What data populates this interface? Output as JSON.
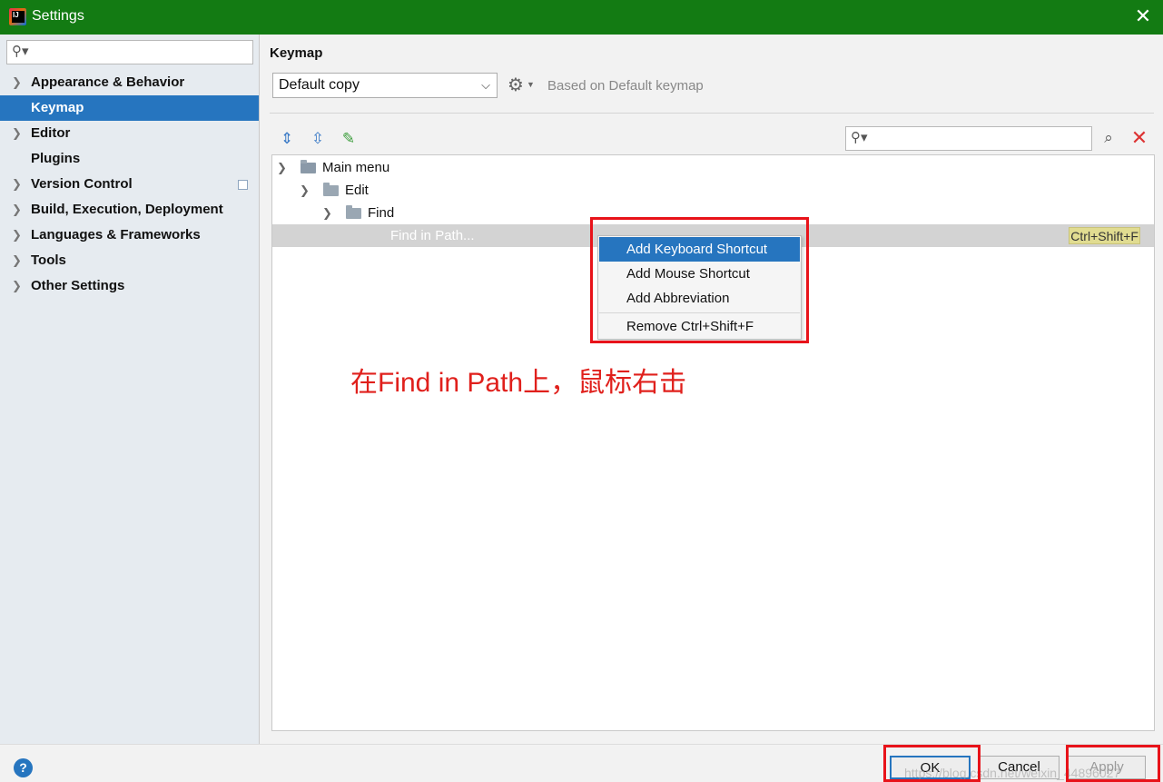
{
  "window": {
    "title": "Settings",
    "close_glyph": "✕",
    "icon": "intellij-idea-icon"
  },
  "sidebar": {
    "search_placeholder": "",
    "items": [
      {
        "label": "Appearance & Behavior",
        "expandable": true,
        "selected": false
      },
      {
        "label": "Keymap",
        "expandable": false,
        "selected": true
      },
      {
        "label": "Editor",
        "expandable": true,
        "selected": false
      },
      {
        "label": "Plugins",
        "expandable": false,
        "selected": false
      },
      {
        "label": "Version Control",
        "expandable": true,
        "selected": false
      },
      {
        "label": "Build, Execution, Deployment",
        "expandable": true,
        "selected": false
      },
      {
        "label": "Languages & Frameworks",
        "expandable": true,
        "selected": false
      },
      {
        "label": "Tools",
        "expandable": true,
        "selected": false
      },
      {
        "label": "Other Settings",
        "expandable": true,
        "selected": false
      }
    ]
  },
  "main": {
    "title": "Keymap",
    "keymap_select_value": "Default copy",
    "based_on": "Based on Default keymap",
    "tree": [
      {
        "label": "Main menu"
      },
      {
        "label": "Edit"
      },
      {
        "label": "Find"
      },
      {
        "label": "Find in Path...",
        "shortcut": "Ctrl+Shift+F"
      }
    ]
  },
  "context_menu": {
    "items": [
      {
        "label": "Add Keyboard Shortcut",
        "active": true
      },
      {
        "label": "Add Mouse Shortcut",
        "active": false
      },
      {
        "label": "Add Abbreviation",
        "active": false
      },
      {
        "label": "Remove Ctrl+Shift+F",
        "active": false
      }
    ]
  },
  "annotation": "在Find in Path上，鼠标右击",
  "footer": {
    "help_label": "?",
    "ok_label": "OK",
    "cancel_label": "Cancel",
    "apply_label": "Apply",
    "watermark": "https://blog.csdn.net/weixin_44896027"
  },
  "colors": {
    "titlebar": "#137b13",
    "selection": "#2675bf",
    "highlight": "#e8131a"
  }
}
